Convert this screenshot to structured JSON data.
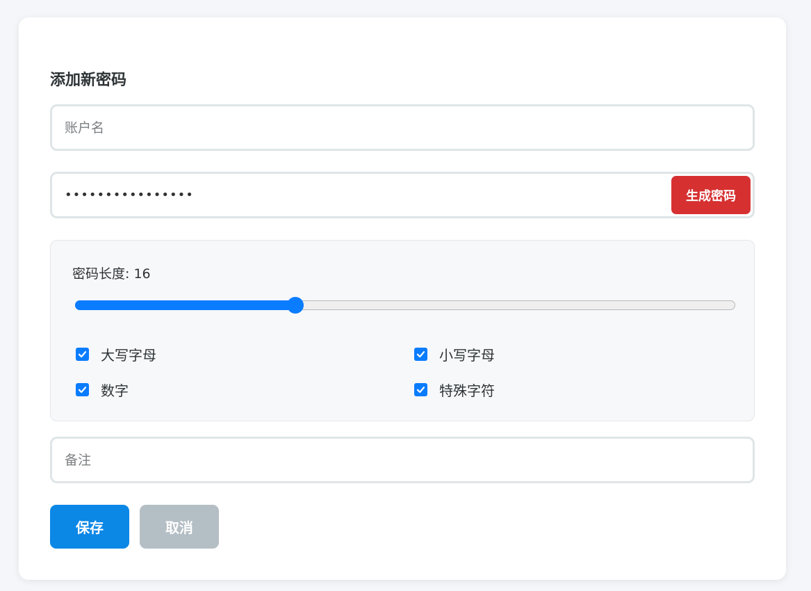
{
  "form": {
    "title": "添加新密码",
    "account": {
      "placeholder": "账户名",
      "value": ""
    },
    "password": {
      "value": "••••••••••••••••",
      "generate_label": "生成密码"
    },
    "length": {
      "label_prefix": "密码长度: ",
      "value": 16,
      "min": 8,
      "max": 32
    },
    "options": [
      {
        "label": "大写字母",
        "checked": true
      },
      {
        "label": "小写字母",
        "checked": true
      },
      {
        "label": "数字",
        "checked": true
      },
      {
        "label": "特殊字符",
        "checked": true
      }
    ],
    "note": {
      "placeholder": "备注",
      "value": ""
    },
    "save_label": "保存",
    "cancel_label": "取消"
  },
  "colors": {
    "accent": "#0a7cff",
    "generate": "#d63031",
    "save": "#0b87e6",
    "cancel": "#b4bec5"
  }
}
